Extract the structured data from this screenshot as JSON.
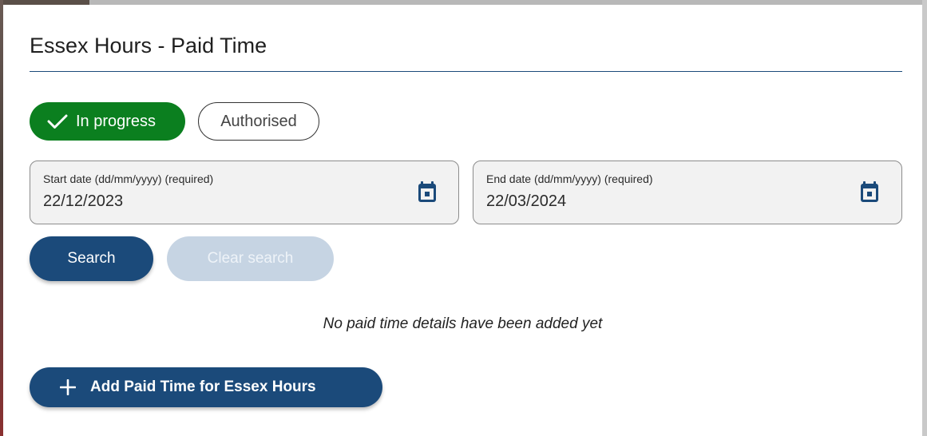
{
  "dialog": {
    "title": "Essex Hours - Paid Time"
  },
  "status_filters": {
    "items": [
      {
        "label": "In progress",
        "selected": true,
        "icon": "check-icon"
      },
      {
        "label": "Authorised",
        "selected": false
      }
    ]
  },
  "start_date": {
    "label": "Start date (dd/mm/yyyy) (required)",
    "value": "22/12/2023",
    "icon": "calendar-icon"
  },
  "end_date": {
    "label": "End date (dd/mm/yyyy) (required)",
    "value": "22/03/2024",
    "icon": "calendar-icon"
  },
  "actions": {
    "search_label": "Search",
    "clear_label": "Clear search",
    "clear_disabled": true,
    "add_label": "Add Paid Time for Essex Hours",
    "add_icon": "plus-icon"
  },
  "empty_state": {
    "message": "No paid time details have been added yet"
  },
  "colors": {
    "primary": "#1b4a7a",
    "success": "#0b7f1f",
    "disabled": "#c6d4e3",
    "field_bg": "#f2f2f2"
  }
}
